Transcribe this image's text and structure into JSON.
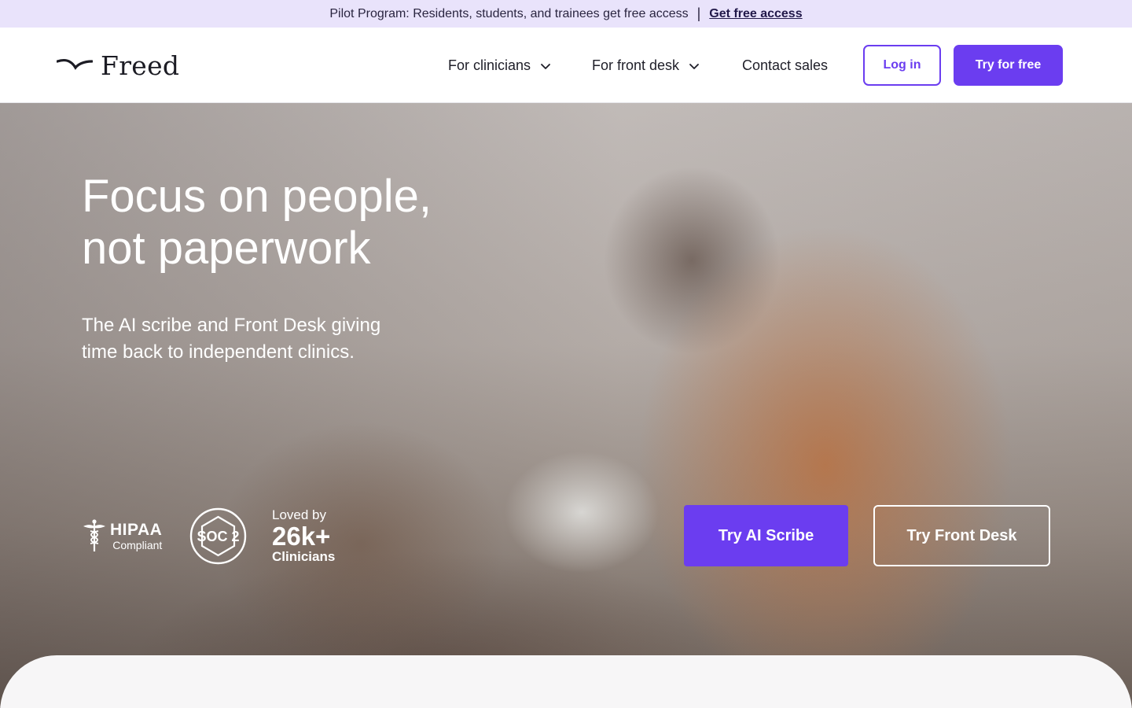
{
  "banner": {
    "text": "Pilot Program: Residents, students, and trainees get free access",
    "separator": "|",
    "link": "Get free access"
  },
  "nav": {
    "logo_text": "Freed",
    "menu": [
      {
        "label": "For clinicians",
        "has_dropdown": true
      },
      {
        "label": "For front desk",
        "has_dropdown": true
      },
      {
        "label": "Contact sales",
        "has_dropdown": false
      }
    ],
    "login_label": "Log in",
    "try_label": "Try for free"
  },
  "hero": {
    "title_line1": "Focus on people,",
    "title_line2": "not paperwork",
    "subtitle_line1": "The AI scribe and Front Desk giving",
    "subtitle_line2": "time back to independent clinics.",
    "hipaa_title": "HIPAA",
    "hipaa_sub": "Compliant",
    "soc_label": "SOC 2",
    "loved_by": "Loved by",
    "loved_count": "26k+",
    "loved_who": "Clinicians",
    "cta_scribe": "Try AI Scribe",
    "cta_front": "Try Front Desk"
  },
  "colors": {
    "accent": "#6b3df0",
    "banner_bg": "#e9e3fb",
    "text_dark": "#1e1e28"
  },
  "icons": [
    "freed-logo-icon",
    "chevron-down-icon",
    "caduceus-icon",
    "soc2-badge-icon"
  ]
}
